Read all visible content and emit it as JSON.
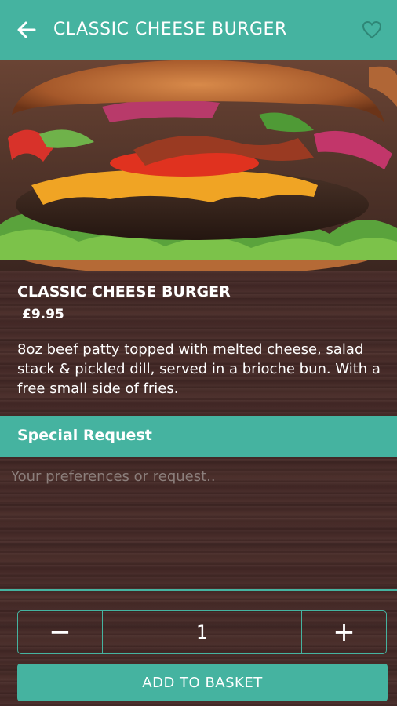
{
  "header": {
    "title": "CLASSIC CHEESE BURGER",
    "back_icon": "arrow-left-icon",
    "favorite_icon": "heart-outline-icon"
  },
  "hero": {
    "image": "burger-photo"
  },
  "item": {
    "name": "CLASSIC CHEESE BURGER",
    "price": "£9.95",
    "description": "8oz beef patty topped with melted cheese, salad stack & pickled dill, served in a brioche bun. With a free small side of fries."
  },
  "special_request": {
    "label": "Special Request",
    "placeholder": "Your preferences or request..",
    "value": ""
  },
  "quantity": {
    "minus_label": "−",
    "value": "1",
    "plus_label": "+"
  },
  "add_button": {
    "label": "ADD TO BASKET"
  },
  "colors": {
    "accent": "#45b3a0",
    "background": "#432826",
    "text": "#ffffff",
    "placeholder": "#8c7f7c"
  }
}
